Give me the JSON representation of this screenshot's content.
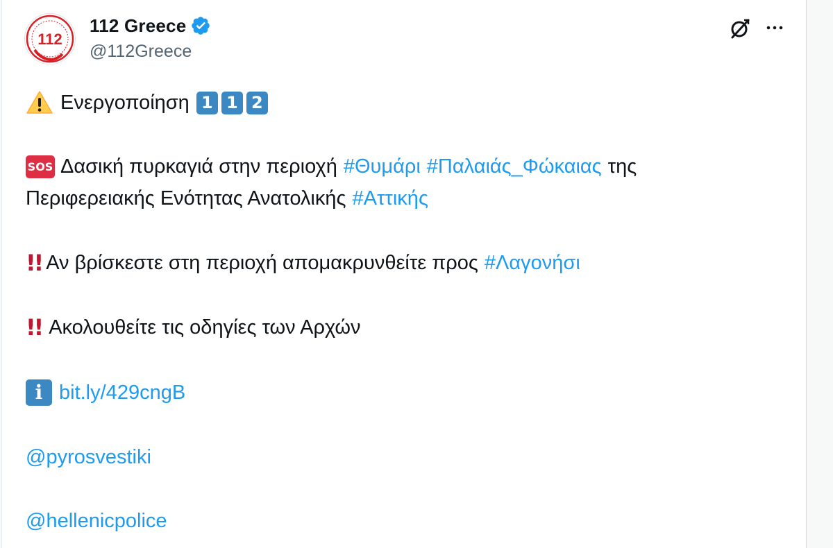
{
  "tweet": {
    "display_name": "112 Greece",
    "handle": "@112Greece",
    "avatar_text": "112",
    "lines": {
      "l1": {
        "text": "Ενεργοποίηση",
        "keycaps": [
          "1",
          "1",
          "2"
        ]
      },
      "l2": {
        "badge": "SOS",
        "text1": "Δασική πυρκαγιά στην περιοχή",
        "tag1": "#Θυμάρι",
        "tag2": "#Παλαιάς_Φώκαιας",
        "text2": "της"
      },
      "l3": {
        "text": "Περιφερειακής Ενότητας Ανατολικής",
        "tag": "#Αττικής"
      },
      "l4": {
        "bang": "!!",
        "text": "Αν βρίσκεστε στη περιοχή απομακρυνθείτε προς",
        "tag": "#Λαγονήσι"
      },
      "l5": {
        "bang": "!!",
        "text": "Ακολουθείτε τις οδηγίες των Αρχών"
      },
      "l6": {
        "info": "i",
        "link": "bit.ly/429cngB"
      },
      "l7": {
        "mention": "@pyrosvestiki"
      },
      "l8": {
        "mention": "@hellenicpolice"
      }
    }
  },
  "icons": {
    "verified": "verified-badge-icon",
    "grok": "grok-icon",
    "more": "more-options-icon",
    "warning": "warning-icon"
  },
  "colors": {
    "link": "#1d9bf0",
    "text": "#0f1419",
    "secondary": "#536471",
    "verified": "#1d9bf0",
    "avatar_red": "#d91f26",
    "keycap_blue": "#3b88c3",
    "sos_red": "#dd2e44",
    "bang_red": "#be1931"
  }
}
